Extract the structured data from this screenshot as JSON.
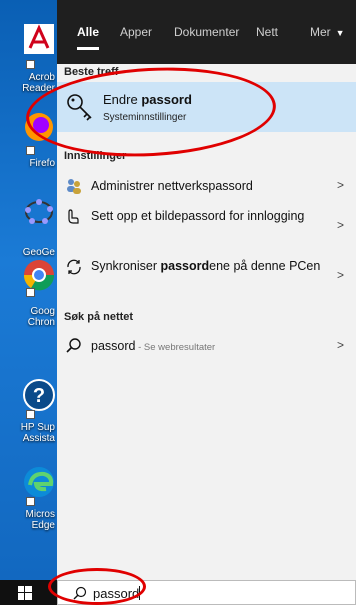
{
  "desktop": {
    "icons": [
      {
        "name": "acrobat",
        "label": "Acrob\nReader"
      },
      {
        "name": "firefox",
        "label": "Firefo"
      },
      {
        "name": "geogebra",
        "label": "GeoGe"
      },
      {
        "name": "chrome",
        "label": "Goog\nChron"
      },
      {
        "name": "hp-support",
        "label": "HP Sup\nAssista"
      },
      {
        "name": "edge",
        "label": "Micros\nEdge"
      }
    ]
  },
  "tabs": [
    {
      "label": "Alle",
      "active": true
    },
    {
      "label": "Apper"
    },
    {
      "label": "Dokumenter"
    },
    {
      "label": "Nett"
    },
    {
      "label": "Mer"
    }
  ],
  "best_match": {
    "heading": "Beste treff",
    "title_plain": "Endre ",
    "title_bold": "passord",
    "subtitle": "Systeminnstillinger"
  },
  "settings": {
    "heading": "Innstillinger",
    "items": [
      {
        "icon": "network-users-icon",
        "text": "Administrer nettverkspassord"
      },
      {
        "icon": "picture-password-icon",
        "text": "Sett opp et bildepassord for innlogging"
      },
      {
        "icon": "sync-icon",
        "text_before": "Synkroniser ",
        "text_bold": "passord",
        "text_after": "ene på denne PCen"
      }
    ]
  },
  "web": {
    "heading": "Søk på nettet",
    "query": "passord",
    "suffix": " - Se webresultater"
  },
  "search": {
    "value": "passord"
  },
  "colors": {
    "annotation": "#e00000",
    "highlight": "#cce4f7",
    "topbar": "#1f1f1f"
  }
}
